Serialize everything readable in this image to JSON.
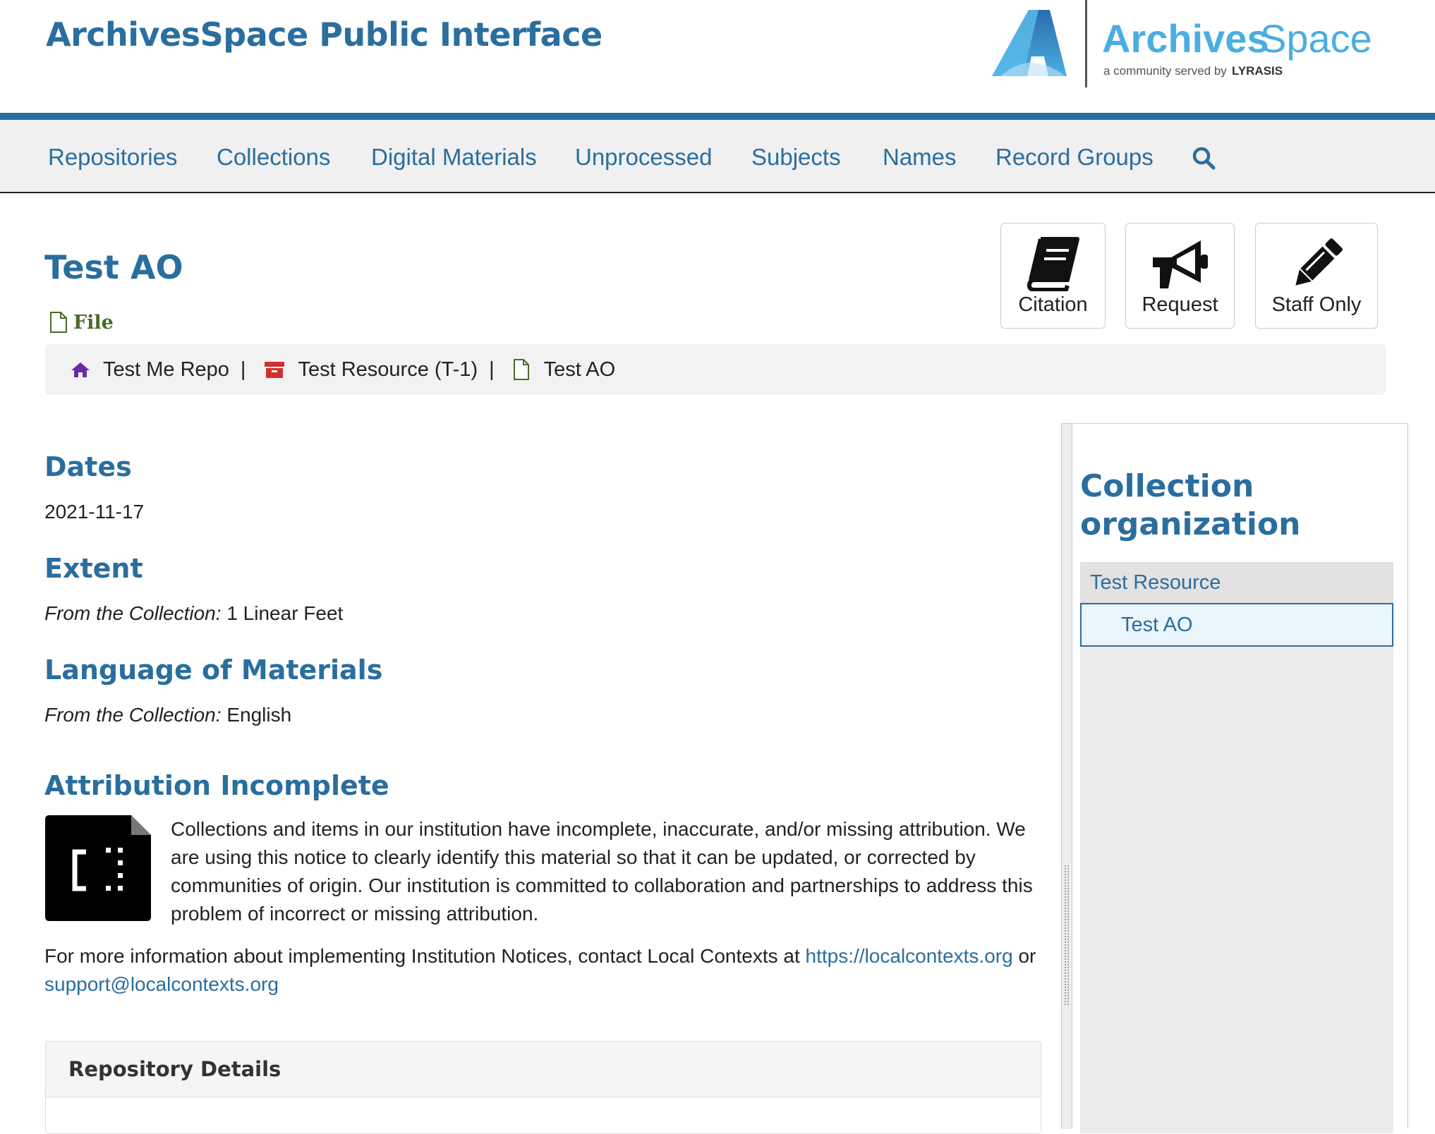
{
  "header": {
    "site_title": "ArchivesSpace Public Interface",
    "logo": {
      "wordmark_part1": "Archives",
      "wordmark_part2": "Space",
      "tagline": "a community served by",
      "tagline_brand": "LYRASIS"
    }
  },
  "nav": {
    "items": [
      {
        "label": "Repositories"
      },
      {
        "label": "Collections"
      },
      {
        "label": "Digital Materials"
      },
      {
        "label": "Unprocessed"
      },
      {
        "label": "Subjects"
      },
      {
        "label": "Names"
      },
      {
        "label": "Record Groups"
      }
    ],
    "search_icon": "search-icon"
  },
  "record": {
    "title": "Test AO",
    "level": "File"
  },
  "actions": {
    "citation": "Citation",
    "request": "Request",
    "staff_only": "Staff Only"
  },
  "breadcrumb": {
    "items": [
      {
        "label": "Test Me Repo",
        "icon": "home-icon"
      },
      {
        "label": "Test Resource (T-1)",
        "icon": "archive-box-icon"
      },
      {
        "label": "Test AO",
        "icon": "file-icon"
      }
    ],
    "separator": "|"
  },
  "sections": {
    "dates": {
      "heading": "Dates",
      "value": "2021-11-17"
    },
    "extent": {
      "heading": "Extent",
      "prefix": "From the Collection:",
      "value": " 1 Linear Feet"
    },
    "language": {
      "heading": "Language of Materials",
      "prefix": "From the Collection:",
      "value": " English"
    },
    "attribution": {
      "heading": "Attribution Incomplete",
      "text": "Collections and items in our institution have incomplete, inaccurate, and/or missing attribution. We are using this notice to clearly identify this material so that it can be updated, or corrected by communities of origin. Our institution is committed to collaboration and partnerships to address this problem of incorrect or missing attribution.",
      "more_info_text": "For more information about implementing Institution Notices, contact Local Contexts at ",
      "link1": "https://localcontexts.org",
      "or_text": " or ",
      "link2": "support@localcontexts.org"
    },
    "repository_details": {
      "heading": "Repository Details"
    }
  },
  "sidebar": {
    "title": "Collection organization",
    "tree": [
      {
        "label": "Test Resource"
      },
      {
        "label": "Test AO",
        "selected": true
      }
    ]
  },
  "colors": {
    "brand_blue": "#2a6e9e",
    "level_green": "#4a6a2a",
    "home_purple": "#6a2aa8",
    "box_red": "#d03030"
  }
}
